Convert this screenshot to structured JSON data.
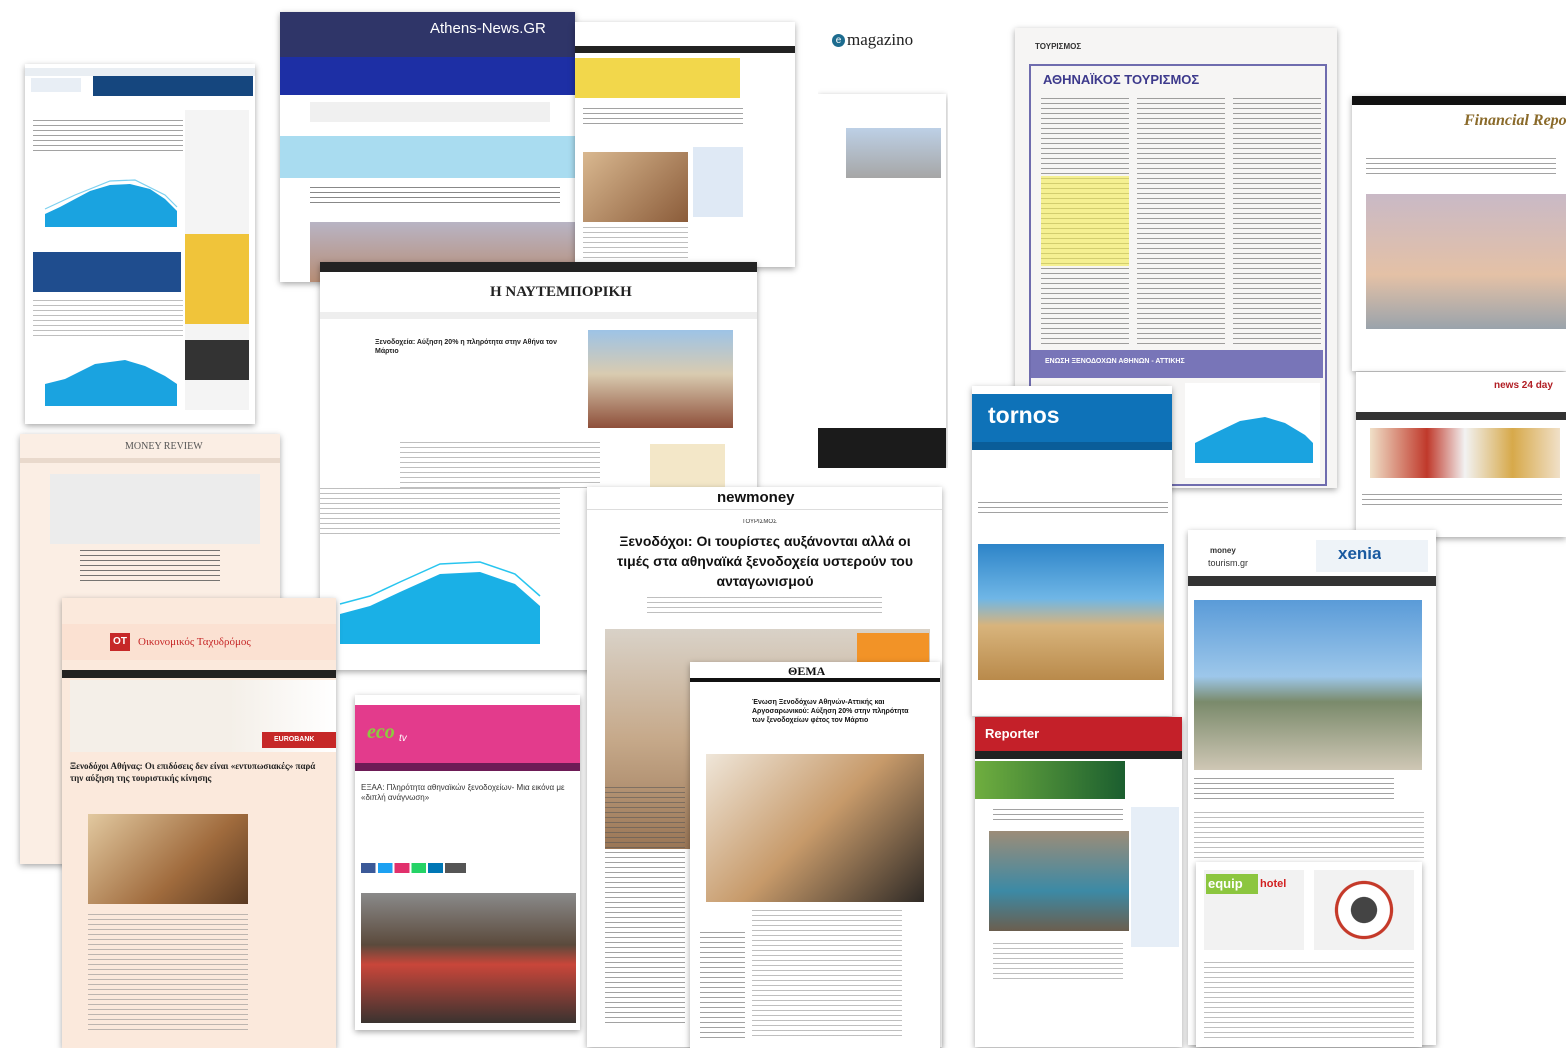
{
  "clippings": {
    "athens_news": {
      "title": "Athens-News.GR"
    },
    "newmoney": {
      "logo": "newmoney",
      "category": "ΤΟΥΡΙΣΜΟΣ",
      "headline": "Ξενοδόχοι: Οι τουρίστες αυξάνονται αλλά οι τιμές στα αθηναϊκά ξενοδοχεία υστερούν του ανταγωνισμού"
    },
    "naftemporiki": {
      "logo": "Η ΝΑΥΤΕΜΠΟΡΙΚΗ",
      "headline": "Ξενοδοχεία: Αύξηση 20% η πληρότητα στην Αθήνα τον Μάρτιο"
    },
    "emagazino": {
      "logo_mark": "e",
      "logo": "magazino"
    },
    "tourismos": {
      "section": "ΤΟΥΡΙΣΜΟΣ",
      "headline": "ΑΘΗΝΑΪΚΟΣ ΤΟΥΡΙΣΜΟΣ",
      "footer": "ΕΝΩΣΗ ΞΕΝΟΔΟΧΩΝ ΑΘΗΝΩΝ - ΑΤΤΙΚΗΣ"
    },
    "financial_report": {
      "logo": "Financial Report"
    },
    "tornos": {
      "logo": "tornos"
    },
    "money_tourism": {
      "logo_top": "money",
      "logo_bottom": "tourism.gr",
      "banner": "xenia"
    },
    "money_review": {
      "logo": "MONEY REVIEW"
    },
    "oikonomikos": {
      "badge": "ΟΤ",
      "logo": "Οικονομικός Ταχυδρόμος",
      "headline": "Ξενοδόχοι Αθήνας: Οι επιδόσεις δεν είναι «εντυπωσιακές» παρά την αύξηση της τουριστικής κίνησης",
      "sponsor": "EUROBANK"
    },
    "ecotv": {
      "logo": "eco",
      "logo_small": "tv",
      "headline": "ΕΞΑΑ: Πληρότητα αθηναϊκών ξενοδοχείων- Μια εικόνα με «διπλή ανάγνωση»"
    },
    "thema": {
      "logo": "ΘΕΜΑ",
      "headline": "Ένωση Ξενοδόχων Αθηνών-Αττικής και Αργοσαρωνικού: Αύξηση 20% στην πληρότητα των ξενοδοχείων φέτος τον Μάρτιο"
    },
    "reporter": {
      "logo": "Reporter"
    },
    "equip": {
      "logo": "equip",
      "logo2": "hotel"
    },
    "newsday": {
      "logo": "news 24 day"
    }
  }
}
